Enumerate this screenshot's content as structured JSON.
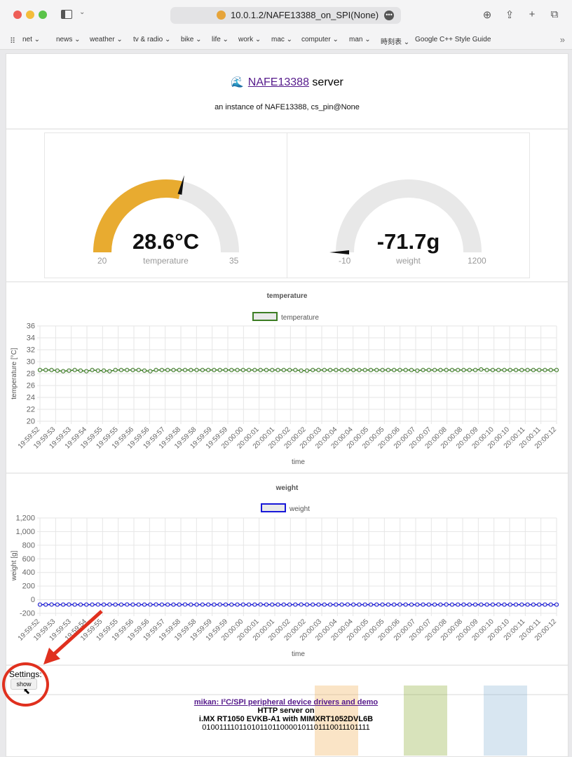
{
  "browser": {
    "url": "10.0.1.2/NAFE13388_on_SPI(None)",
    "bookmarks": [
      "net ⌄",
      "news ⌄",
      "weather ⌄",
      "tv & radio ⌄",
      "bike ⌄",
      "life ⌄",
      "work ⌄",
      "mac ⌄",
      "computer ⌄",
      "man ⌄",
      "時刻表 ⌄",
      "Google C++ Style Guide"
    ]
  },
  "header": {
    "link": "NAFE13388",
    "title_suffix": "server",
    "subtitle": "an instance of NAFE13388, cs_pin@None"
  },
  "gauges": [
    {
      "value_text": "28.6°C",
      "label": "temperature",
      "min": "20",
      "max": "35",
      "value": 28.6,
      "min_v": 20,
      "max_v": 35,
      "color": "#e8ab30"
    },
    {
      "value_text": "-71.7g",
      "label": "weight",
      "min": "-10",
      "max": "1200",
      "value": -71.7,
      "min_v": -10,
      "max_v": 1200,
      "color": "#e8ab30"
    }
  ],
  "chart_data": [
    {
      "type": "line",
      "title": "temperature",
      "series": [
        {
          "name": "temperature",
          "color": "#3c7d24",
          "values": [
            28.6,
            28.6,
            28.6,
            28.5,
            28.4,
            28.5,
            28.6,
            28.5,
            28.4,
            28.6,
            28.5,
            28.5,
            28.4,
            28.6,
            28.6,
            28.6,
            28.6,
            28.6,
            28.5,
            28.4,
            28.6,
            28.6,
            28.6,
            28.6,
            28.6,
            28.6,
            28.6,
            28.6,
            28.6,
            28.6,
            28.6,
            28.6,
            28.6,
            28.6,
            28.6,
            28.6,
            28.6,
            28.6,
            28.6,
            28.6,
            28.6,
            28.6,
            28.6,
            28.6,
            28.6,
            28.5,
            28.5,
            28.6,
            28.6,
            28.6,
            28.6,
            28.6,
            28.6,
            28.6,
            28.6,
            28.6,
            28.6,
            28.6,
            28.6,
            28.6,
            28.6,
            28.6,
            28.6,
            28.6,
            28.6,
            28.5,
            28.6,
            28.6,
            28.6,
            28.6,
            28.6,
            28.6,
            28.6,
            28.6,
            28.6,
            28.6,
            28.7,
            28.6,
            28.6,
            28.6,
            28.6,
            28.6,
            28.6,
            28.6,
            28.6,
            28.6,
            28.6,
            28.6,
            28.6,
            28.6
          ]
        }
      ],
      "xlabel": "time",
      "ylabel": "temperature [°C]",
      "ylim": [
        20,
        36
      ],
      "yticks": [
        "36",
        "34",
        "32",
        "30",
        "28",
        "26",
        "24",
        "22",
        "20"
      ],
      "xticks": [
        "19:59:52",
        "19:59:53",
        "19:59:53",
        "19:59:54",
        "19:59:55",
        "19:59:55",
        "19:59:56",
        "19:59:56",
        "19:59:57",
        "19:59:58",
        "19:59:58",
        "19:59:59",
        "19:59:59",
        "20:00:00",
        "20:00:01",
        "20:00:01",
        "20:00:02",
        "20:00:02",
        "20:00:03",
        "20:00:04",
        "20:00:04",
        "20:00:05",
        "20:00:05",
        "20:00:06",
        "20:00:07",
        "20:00:07",
        "20:00:08",
        "20:00:08",
        "20:00:09",
        "20:00:10",
        "20:00:10",
        "20:00:11",
        "20:00:11",
        "20:00:12"
      ]
    },
    {
      "type": "line",
      "title": "weight",
      "series": [
        {
          "name": "weight",
          "color": "#1818d8",
          "values": [
            -72,
            -72,
            -71,
            -72,
            -72,
            -71,
            -72,
            -72,
            -72,
            -72,
            -71,
            -72,
            -71,
            -72,
            -72,
            -71,
            -72,
            -72,
            -72,
            -72,
            -71,
            -72,
            -72,
            -72,
            -72,
            -71,
            -72,
            -72,
            -72,
            -72,
            -72,
            -71,
            -72,
            -72,
            -72,
            -72,
            -72,
            -72,
            -71,
            -72,
            -72,
            -72,
            -72,
            -72,
            -72,
            -71,
            -72,
            -72,
            -72,
            -72,
            -72,
            -72,
            -72,
            -71,
            -72,
            -72,
            -72,
            -72,
            -72,
            -72,
            -72,
            -72,
            -71,
            -72,
            -72,
            -72,
            -72,
            -72,
            -72,
            -72,
            -71,
            -72,
            -72,
            -72,
            -72,
            -72,
            -72,
            -72,
            -72,
            -71,
            -72,
            -72,
            -72,
            -72,
            -72,
            -72,
            -72,
            -72,
            -72,
            -72
          ]
        }
      ],
      "xlabel": "time",
      "ylabel": "weight [g]",
      "ylim": [
        -200,
        1200
      ],
      "yticks": [
        "1,200",
        "1,000",
        "800",
        "600",
        "400",
        "200",
        "0",
        "-200"
      ],
      "xticks": [
        "19:59:52",
        "19:59:53",
        "19:59:53",
        "19:59:54",
        "19:59:55",
        "19:59:55",
        "19:59:56",
        "19:59:56",
        "19:59:57",
        "19:59:58",
        "19:59:58",
        "19:59:59",
        "19:59:59",
        "20:00:00",
        "20:00:01",
        "20:00:01",
        "20:00:02",
        "20:00:02",
        "20:00:03",
        "20:00:04",
        "20:00:04",
        "20:00:05",
        "20:00:05",
        "20:00:06",
        "20:00:07",
        "20:00:07",
        "20:00:08",
        "20:00:08",
        "20:00:09",
        "20:00:10",
        "20:00:10",
        "20:00:11",
        "20:00:11",
        "20:00:12"
      ]
    }
  ],
  "settings": {
    "label": "Settings:",
    "button": "show"
  },
  "footer": {
    "link": "mikan: I²C/SPI peripheral device drivers and demo",
    "line2": "HTTP server on",
    "line3": "i.MX RT1050 EVKB-A1 with MIMXRT1052DVL6B",
    "line4": "01001111011010110110000101101110011101111"
  }
}
